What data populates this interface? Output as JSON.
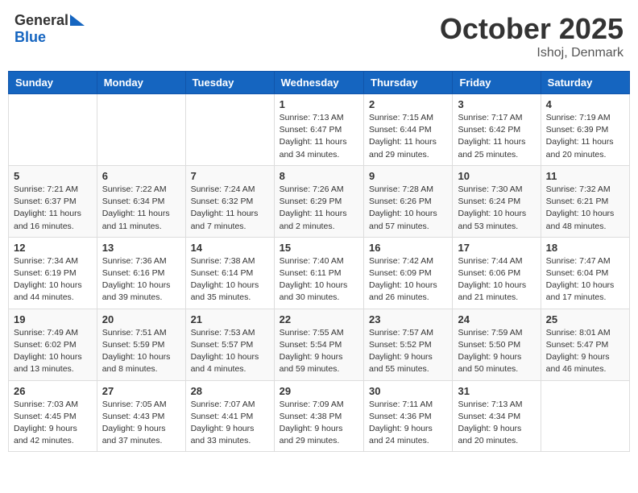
{
  "logo": {
    "general": "General",
    "blue": "Blue"
  },
  "title": {
    "month": "October 2025",
    "location": "Ishoj, Denmark"
  },
  "headers": [
    "Sunday",
    "Monday",
    "Tuesday",
    "Wednesday",
    "Thursday",
    "Friday",
    "Saturday"
  ],
  "weeks": [
    [
      {
        "day": "",
        "info": ""
      },
      {
        "day": "",
        "info": ""
      },
      {
        "day": "",
        "info": ""
      },
      {
        "day": "1",
        "info": "Sunrise: 7:13 AM\nSunset: 6:47 PM\nDaylight: 11 hours\nand 34 minutes."
      },
      {
        "day": "2",
        "info": "Sunrise: 7:15 AM\nSunset: 6:44 PM\nDaylight: 11 hours\nand 29 minutes."
      },
      {
        "day": "3",
        "info": "Sunrise: 7:17 AM\nSunset: 6:42 PM\nDaylight: 11 hours\nand 25 minutes."
      },
      {
        "day": "4",
        "info": "Sunrise: 7:19 AM\nSunset: 6:39 PM\nDaylight: 11 hours\nand 20 minutes."
      }
    ],
    [
      {
        "day": "5",
        "info": "Sunrise: 7:21 AM\nSunset: 6:37 PM\nDaylight: 11 hours\nand 16 minutes."
      },
      {
        "day": "6",
        "info": "Sunrise: 7:22 AM\nSunset: 6:34 PM\nDaylight: 11 hours\nand 11 minutes."
      },
      {
        "day": "7",
        "info": "Sunrise: 7:24 AM\nSunset: 6:32 PM\nDaylight: 11 hours\nand 7 minutes."
      },
      {
        "day": "8",
        "info": "Sunrise: 7:26 AM\nSunset: 6:29 PM\nDaylight: 11 hours\nand 2 minutes."
      },
      {
        "day": "9",
        "info": "Sunrise: 7:28 AM\nSunset: 6:26 PM\nDaylight: 10 hours\nand 57 minutes."
      },
      {
        "day": "10",
        "info": "Sunrise: 7:30 AM\nSunset: 6:24 PM\nDaylight: 10 hours\nand 53 minutes."
      },
      {
        "day": "11",
        "info": "Sunrise: 7:32 AM\nSunset: 6:21 PM\nDaylight: 10 hours\nand 48 minutes."
      }
    ],
    [
      {
        "day": "12",
        "info": "Sunrise: 7:34 AM\nSunset: 6:19 PM\nDaylight: 10 hours\nand 44 minutes."
      },
      {
        "day": "13",
        "info": "Sunrise: 7:36 AM\nSunset: 6:16 PM\nDaylight: 10 hours\nand 39 minutes."
      },
      {
        "day": "14",
        "info": "Sunrise: 7:38 AM\nSunset: 6:14 PM\nDaylight: 10 hours\nand 35 minutes."
      },
      {
        "day": "15",
        "info": "Sunrise: 7:40 AM\nSunset: 6:11 PM\nDaylight: 10 hours\nand 30 minutes."
      },
      {
        "day": "16",
        "info": "Sunrise: 7:42 AM\nSunset: 6:09 PM\nDaylight: 10 hours\nand 26 minutes."
      },
      {
        "day": "17",
        "info": "Sunrise: 7:44 AM\nSunset: 6:06 PM\nDaylight: 10 hours\nand 21 minutes."
      },
      {
        "day": "18",
        "info": "Sunrise: 7:47 AM\nSunset: 6:04 PM\nDaylight: 10 hours\nand 17 minutes."
      }
    ],
    [
      {
        "day": "19",
        "info": "Sunrise: 7:49 AM\nSunset: 6:02 PM\nDaylight: 10 hours\nand 13 minutes."
      },
      {
        "day": "20",
        "info": "Sunrise: 7:51 AM\nSunset: 5:59 PM\nDaylight: 10 hours\nand 8 minutes."
      },
      {
        "day": "21",
        "info": "Sunrise: 7:53 AM\nSunset: 5:57 PM\nDaylight: 10 hours\nand 4 minutes."
      },
      {
        "day": "22",
        "info": "Sunrise: 7:55 AM\nSunset: 5:54 PM\nDaylight: 9 hours\nand 59 minutes."
      },
      {
        "day": "23",
        "info": "Sunrise: 7:57 AM\nSunset: 5:52 PM\nDaylight: 9 hours\nand 55 minutes."
      },
      {
        "day": "24",
        "info": "Sunrise: 7:59 AM\nSunset: 5:50 PM\nDaylight: 9 hours\nand 50 minutes."
      },
      {
        "day": "25",
        "info": "Sunrise: 8:01 AM\nSunset: 5:47 PM\nDaylight: 9 hours\nand 46 minutes."
      }
    ],
    [
      {
        "day": "26",
        "info": "Sunrise: 7:03 AM\nSunset: 4:45 PM\nDaylight: 9 hours\nand 42 minutes."
      },
      {
        "day": "27",
        "info": "Sunrise: 7:05 AM\nSunset: 4:43 PM\nDaylight: 9 hours\nand 37 minutes."
      },
      {
        "day": "28",
        "info": "Sunrise: 7:07 AM\nSunset: 4:41 PM\nDaylight: 9 hours\nand 33 minutes."
      },
      {
        "day": "29",
        "info": "Sunrise: 7:09 AM\nSunset: 4:38 PM\nDaylight: 9 hours\nand 29 minutes."
      },
      {
        "day": "30",
        "info": "Sunrise: 7:11 AM\nSunset: 4:36 PM\nDaylight: 9 hours\nand 24 minutes."
      },
      {
        "day": "31",
        "info": "Sunrise: 7:13 AM\nSunset: 4:34 PM\nDaylight: 9 hours\nand 20 minutes."
      },
      {
        "day": "",
        "info": ""
      }
    ]
  ]
}
